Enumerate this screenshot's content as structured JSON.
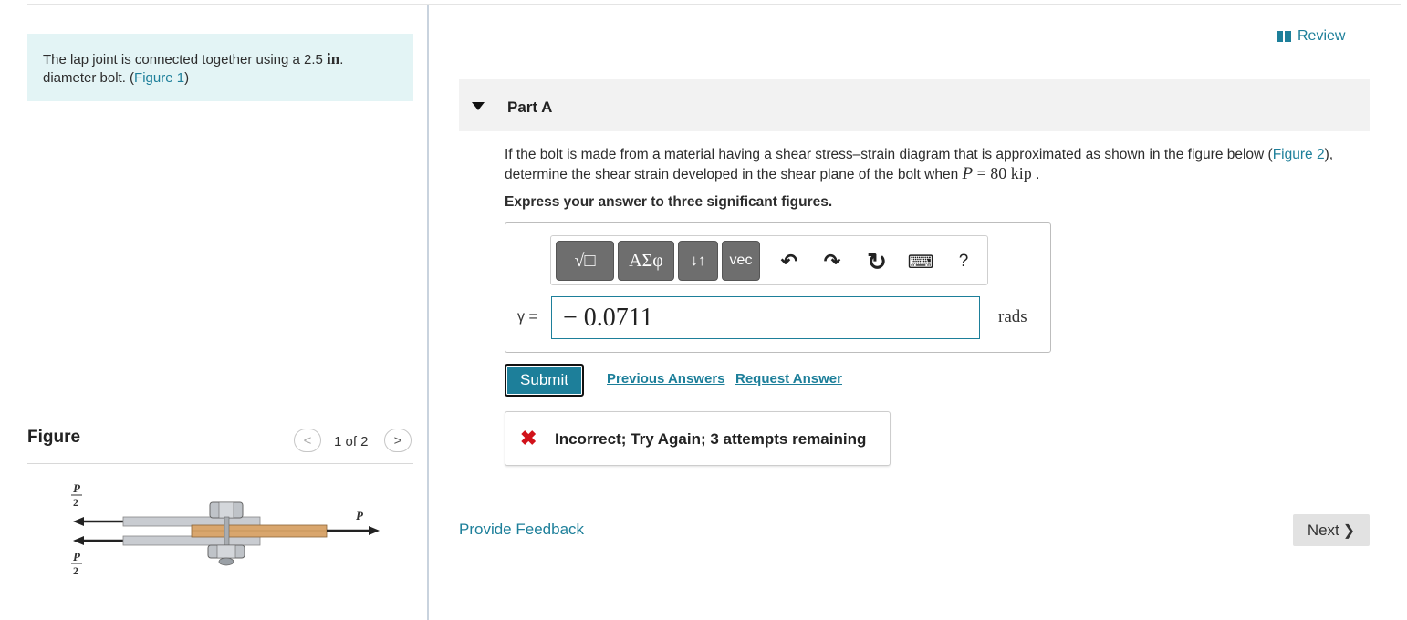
{
  "problem": {
    "text_before": "The lap joint is connected together using a 2.5 ",
    "unit_in": "in",
    "text_middle": ". diameter bolt. (",
    "figure_link": "Figure 1",
    "text_after": ")"
  },
  "figure_panel": {
    "title": "Figure",
    "counter": "1 of 2",
    "prev_glyph": "<",
    "next_glyph": ">",
    "label_half_top_num": "P",
    "label_half_top_den": "2",
    "label_half_bottom_num": "P",
    "label_half_bottom_den": "2",
    "label_p": "P"
  },
  "review": {
    "label": "Review"
  },
  "part": {
    "label": "Part A",
    "question_before": "If the bolt is made from a material having a shear stress–strain diagram that is approximated as shown in the figure below (",
    "question_link": "Figure 2",
    "question_middle": "), determine the shear strain developed in the shear plane of the bolt when ",
    "var_p": "P",
    "equals_80": " = 80 ",
    "unit_kip": "kip",
    "question_end": " .",
    "instruction": "Express your answer to three significant figures."
  },
  "toolbar": {
    "templates_label": "√□",
    "greek_label": "ΑΣφ",
    "arrows_label": "↓↑",
    "vec_label": "vec",
    "undo": "↶",
    "redo": "↷",
    "reset": "↻",
    "keyboard": "⌨",
    "help": "?"
  },
  "answer": {
    "variable_label": "γ =",
    "value": "− 0.0711",
    "units": "rads"
  },
  "actions": {
    "submit": "Submit",
    "previous_answers": "Previous Answers",
    "request_answer": "Request Answer"
  },
  "feedback": {
    "icon": "✖",
    "message": "Incorrect; Try Again; 3 attempts remaining"
  },
  "footer": {
    "provide_feedback": "Provide Feedback",
    "next_label": "Next",
    "next_chevron": "❯"
  },
  "colors": {
    "accent": "#1d7f9a",
    "error": "#d1121a",
    "problem_bg": "#e3f4f5"
  }
}
